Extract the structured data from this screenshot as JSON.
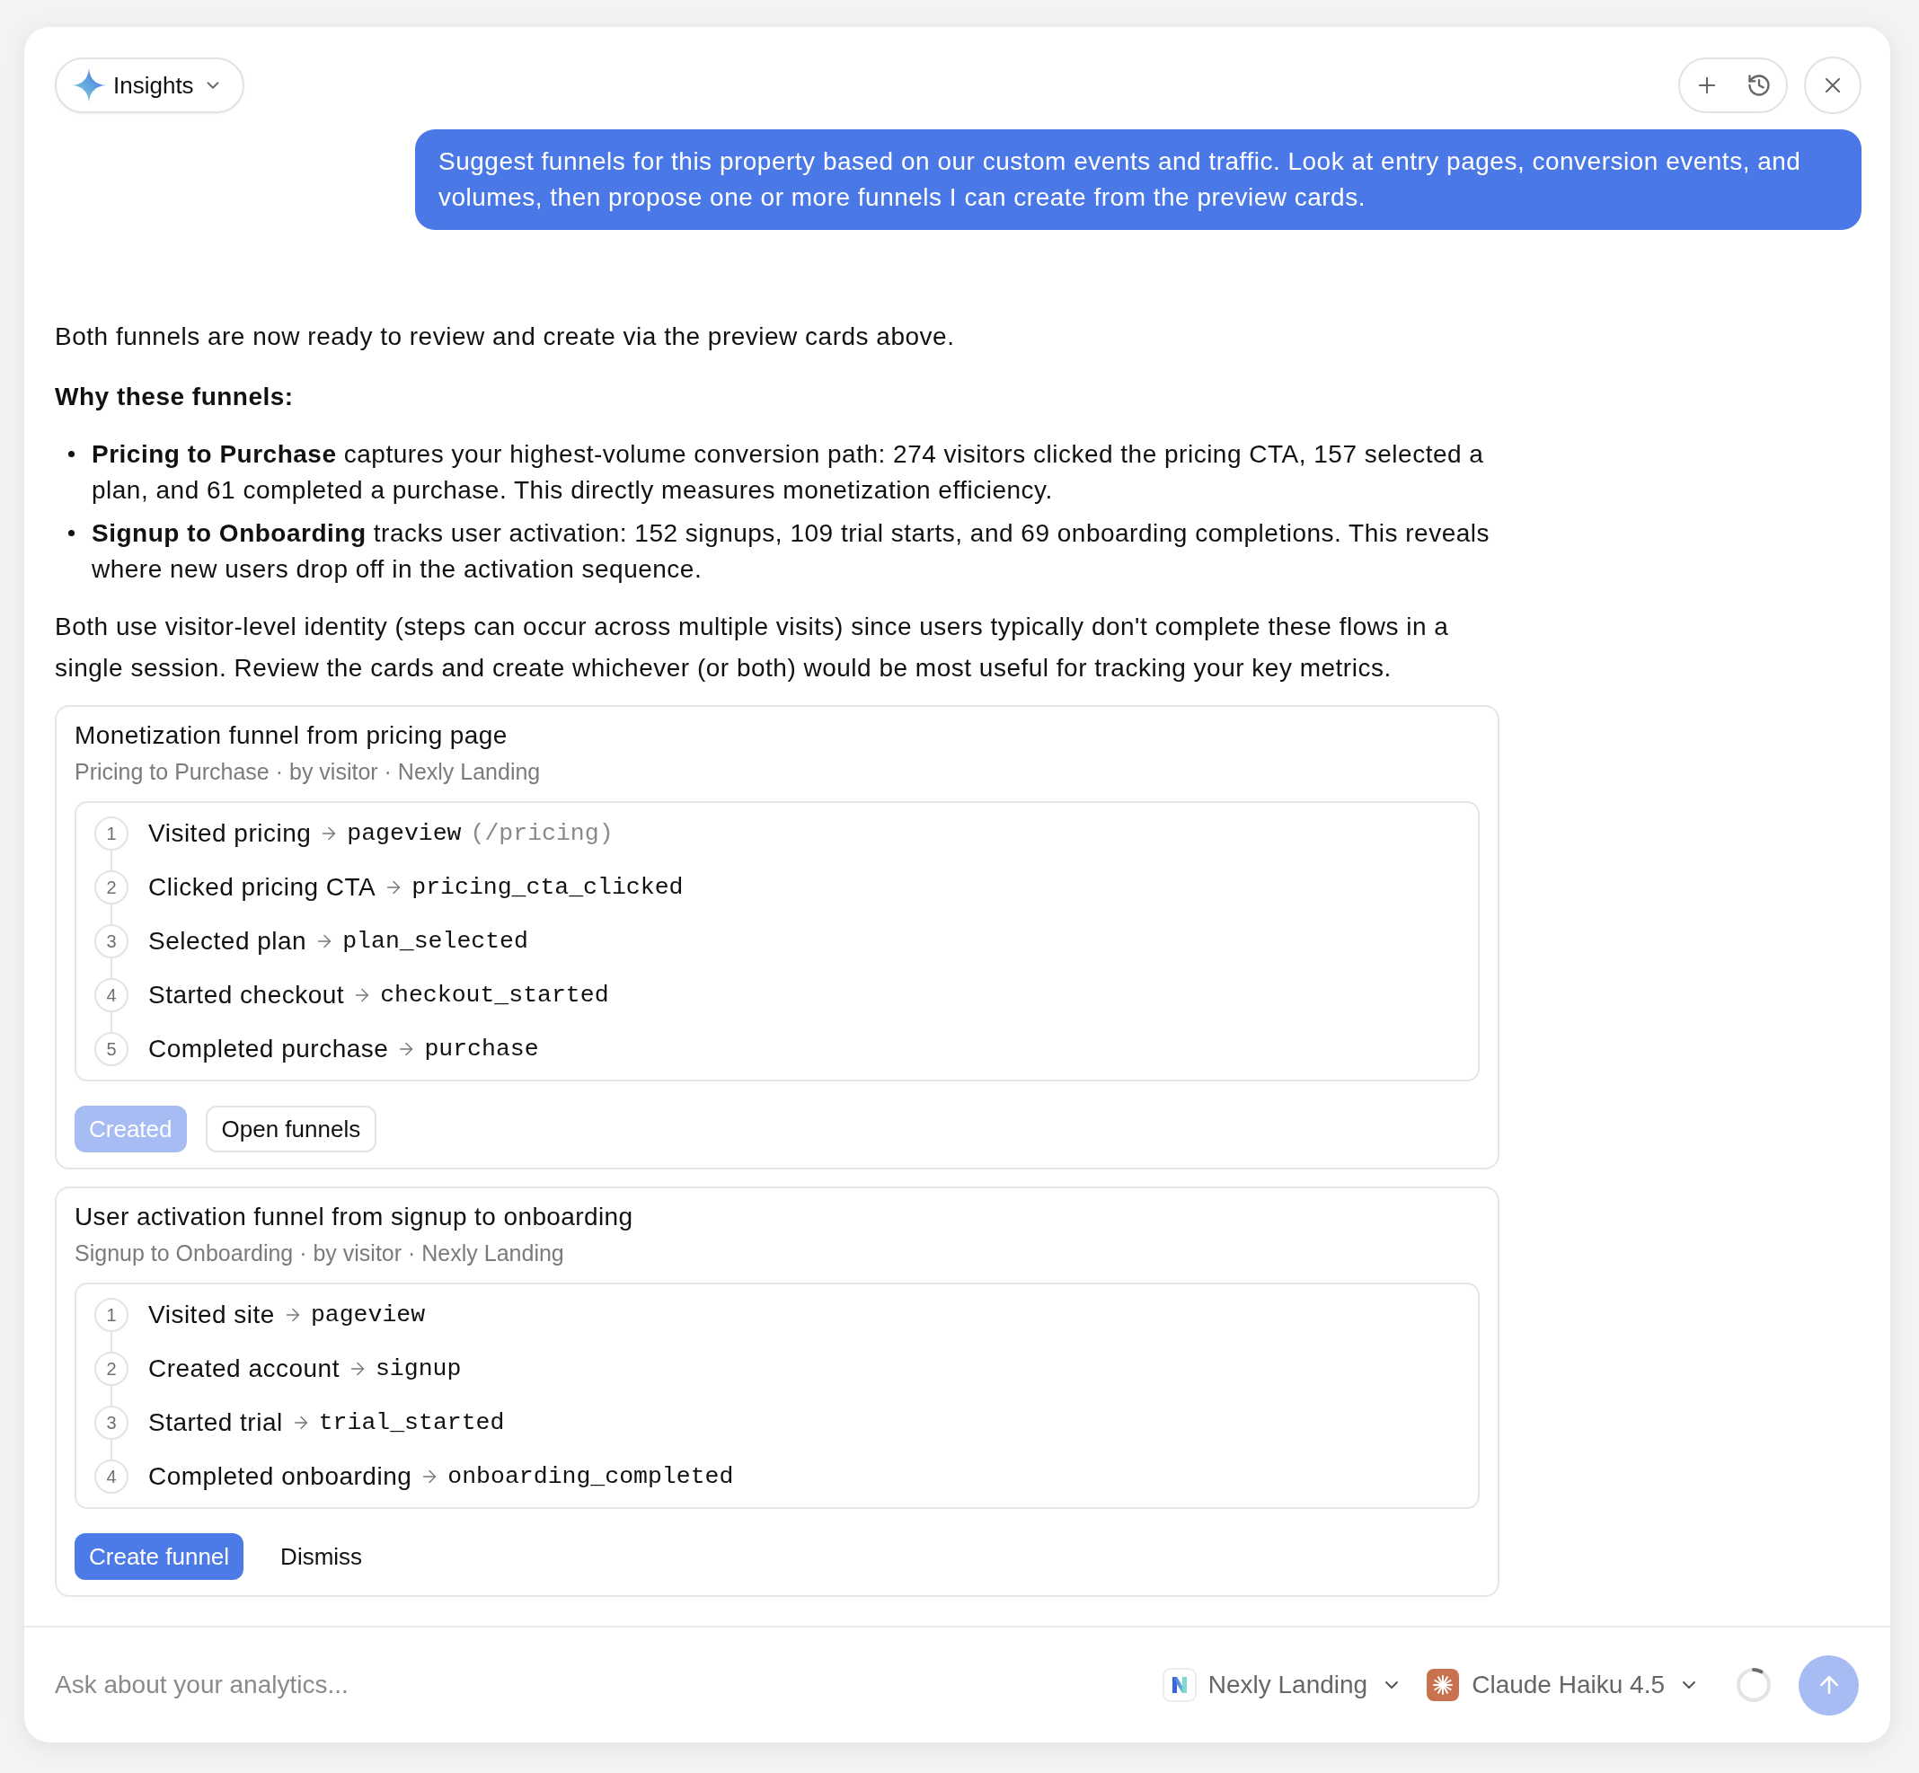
{
  "header": {
    "title": "Insights"
  },
  "user_message": {
    "text": "Suggest funnels for this property based on our custom events and traffic. Look at entry pages, conversion events, and volumes, then propose one or more funnels I can create from the preview cards."
  },
  "assistant_message": {
    "intro": "Both funnels are now ready to review and create via the preview cards above.",
    "heading": "Why these funnels:",
    "bullets": [
      "**Pricing to Purchase** captures your highest-volume conversion path: 274 visitors clicked the pricing CTA, 157 selected a plan, and 61 completed a purchase. This directly measures monetization efficiency.",
      "**Signup to Onboarding** tracks user activation: 152 signups, 109 trial starts, and 69 onboarding completions. This reveals where new users drop off in the activation sequence."
    ],
    "closing": "Both use visitor-level identity (steps can occur across multiple visits) since users typically don't complete these flows in a single session. Review the cards and create whichever (or both) would be most useful for tracking your key metrics."
  },
  "funnel_cards": [
    {
      "title": "Monetization funnel from pricing page",
      "subtitle": "Pricing to Purchase · by visitor · Nexly Landing",
      "steps": [
        {
          "number": "1",
          "label": "Visited pricing",
          "event": "pageview",
          "detail": "(/pricing)"
        },
        {
          "number": "2",
          "label": "Clicked pricing CTA",
          "event": "pricing_cta_clicked"
        },
        {
          "number": "3",
          "label": "Selected plan",
          "event": "plan_selected"
        },
        {
          "number": "4",
          "label": "Started checkout",
          "event": "checkout_started"
        },
        {
          "number": "5",
          "label": "Completed purchase",
          "event": "purchase"
        }
      ],
      "buttons": [
        {
          "label": "Created",
          "kind": "primary",
          "disabled": true
        },
        {
          "label": "Open funnels",
          "kind": "outline",
          "disabled": false
        }
      ]
    },
    {
      "title": "User activation funnel from signup to onboarding",
      "subtitle": "Signup to Onboarding · by visitor · Nexly Landing",
      "steps": [
        {
          "number": "1",
          "label": "Visited site",
          "event": "pageview"
        },
        {
          "number": "2",
          "label": "Created account",
          "event": "signup"
        },
        {
          "number": "3",
          "label": "Started trial",
          "event": "trial_started"
        },
        {
          "number": "4",
          "label": "Completed onboarding",
          "event": "onboarding_completed"
        }
      ],
      "buttons": [
        {
          "label": "Create funnel",
          "kind": "primary",
          "disabled": false
        },
        {
          "label": "Dismiss",
          "kind": "ghost",
          "disabled": false
        }
      ]
    }
  ],
  "composer": {
    "placeholder": "Ask about your analytics...",
    "property": "Nexly Landing",
    "model": "Claude Haiku 4.5",
    "send_button": {
      "disabled": true
    }
  }
}
